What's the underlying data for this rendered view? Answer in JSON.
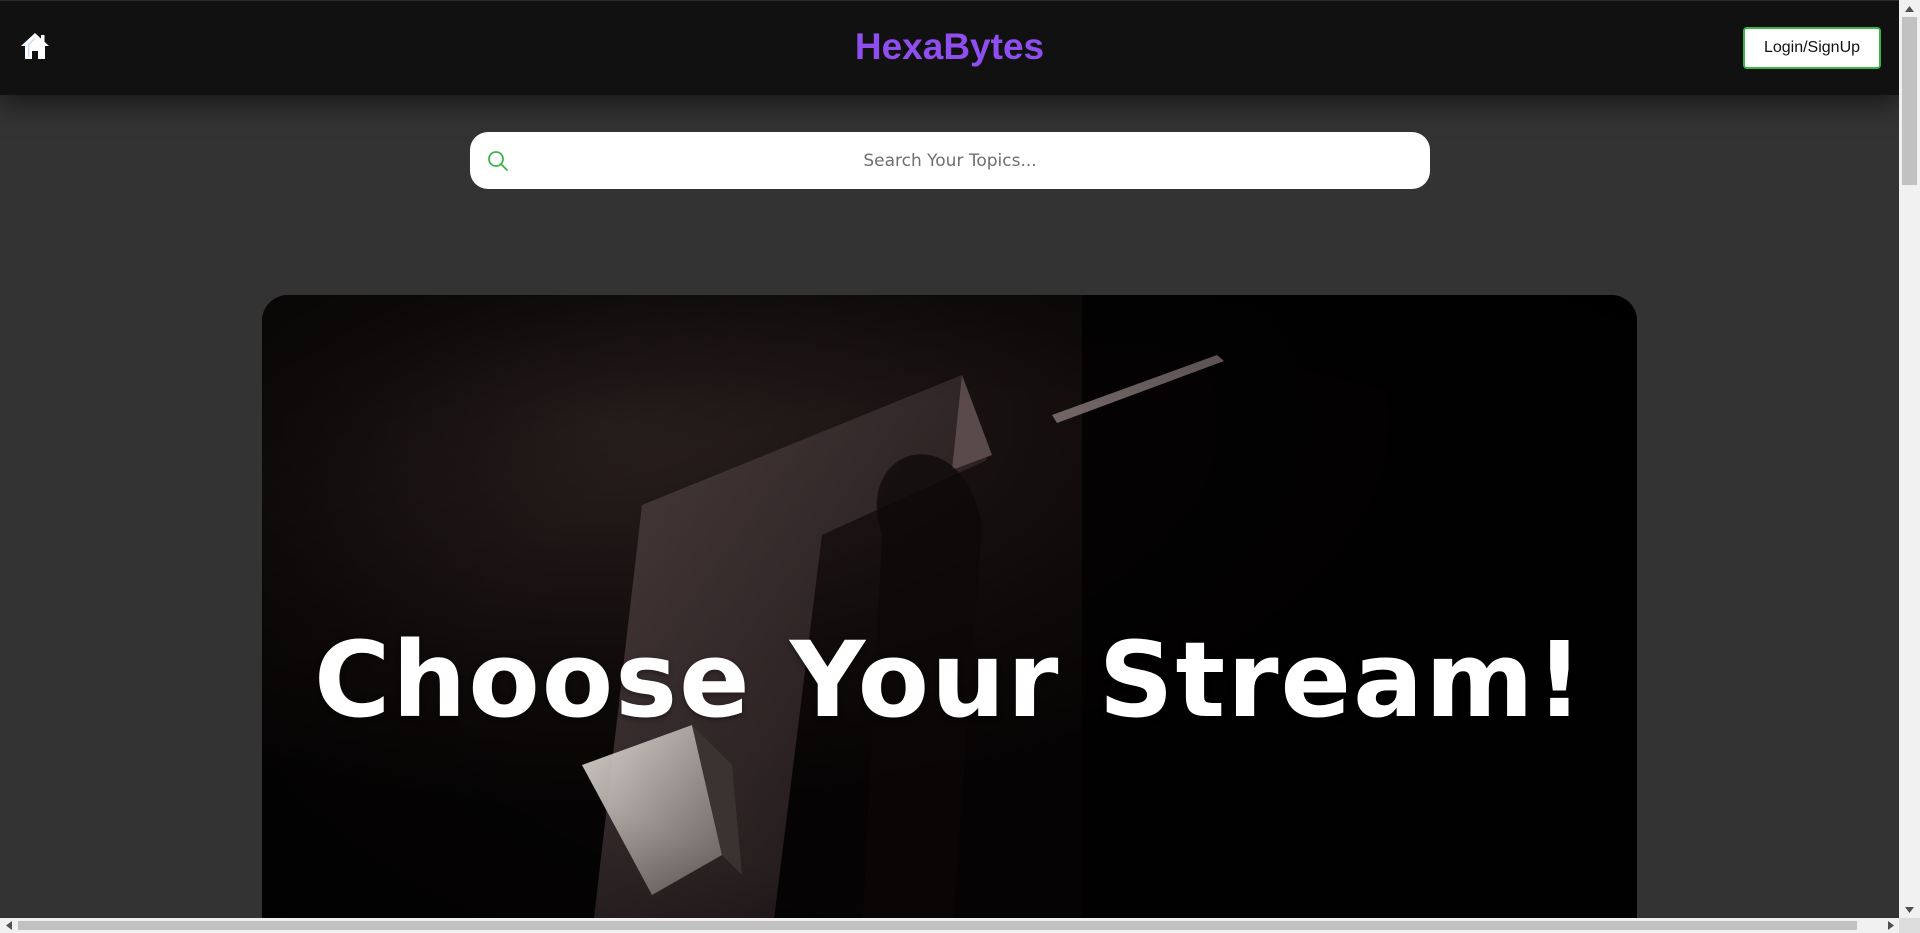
{
  "header": {
    "brand": "HexaBytes",
    "login_label": "Login/SignUp",
    "home_icon": "home-icon",
    "brand_color": "#8f4ff0",
    "login_border_color": "#3cb54a"
  },
  "search": {
    "placeholder": "Search Your Topics...",
    "value": "",
    "icon": "search-icon",
    "icon_color": "#3cb54a"
  },
  "hero": {
    "title": "Choose Your Stream!"
  },
  "colors": {
    "page_background": "#333333",
    "topbar_background": "#111111"
  }
}
